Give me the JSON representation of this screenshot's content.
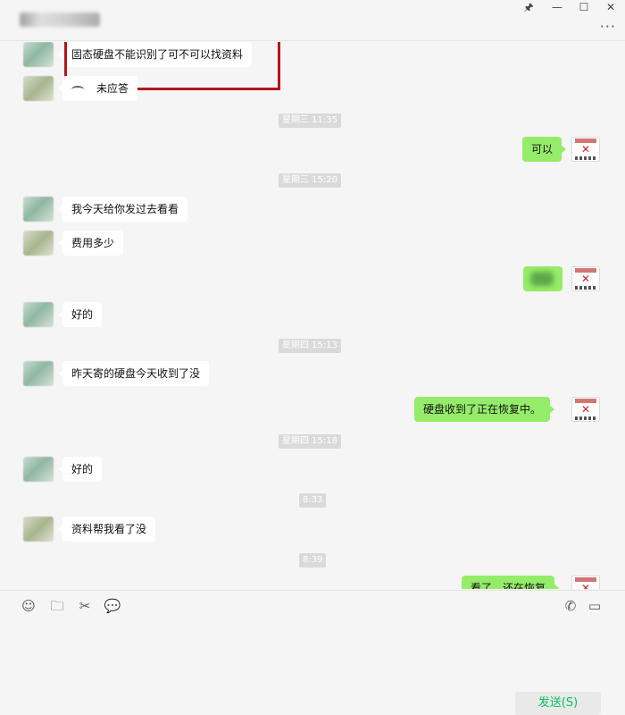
{
  "window": {
    "pin_glyph": "🖈",
    "minimize_glyph": "—",
    "maximize_glyph": "☐",
    "close_glyph": "✕",
    "more_glyph": "···"
  },
  "messages": [
    {
      "side": "in",
      "text": "固态硬盘不能识别了可不可以找资料"
    },
    {
      "side": "in",
      "text": "未应答"
    },
    {
      "type": "time",
      "text": "星期三 11:35"
    },
    {
      "side": "out",
      "text": "可以"
    },
    {
      "type": "time",
      "text": "星期三 15:20"
    },
    {
      "side": "in",
      "text": "我今天给你发过去看看"
    },
    {
      "side": "in",
      "text": "费用多少"
    },
    {
      "side": "in",
      "text": "好的"
    },
    {
      "type": "time",
      "text": "星期四 15:13"
    },
    {
      "side": "in",
      "text": "昨天寄的硬盘今天收到了没"
    },
    {
      "side": "out",
      "text": "硬盘收到了正在恢复中。"
    },
    {
      "type": "time",
      "text": "星期四 15:18"
    },
    {
      "side": "in",
      "text": "好的"
    },
    {
      "type": "time",
      "text": "8:33"
    },
    {
      "side": "in",
      "text": "资料帮我看了没"
    },
    {
      "type": "time",
      "text": "8:39"
    },
    {
      "side": "out",
      "text": "看了，还在恢复"
    }
  ],
  "toolbar": {
    "emoji_glyph": "☺",
    "folder_glyph": "🗀",
    "scissors_glyph": "✂",
    "chat_glyph": "💬",
    "phone_glyph": "✆",
    "video_glyph": "▭"
  },
  "send_label": "发送(S)",
  "colors": {
    "out_bubble": "#95ec69",
    "in_bubble": "#ffffff",
    "highlight": "#b3161c",
    "send_text": "#07c160"
  }
}
